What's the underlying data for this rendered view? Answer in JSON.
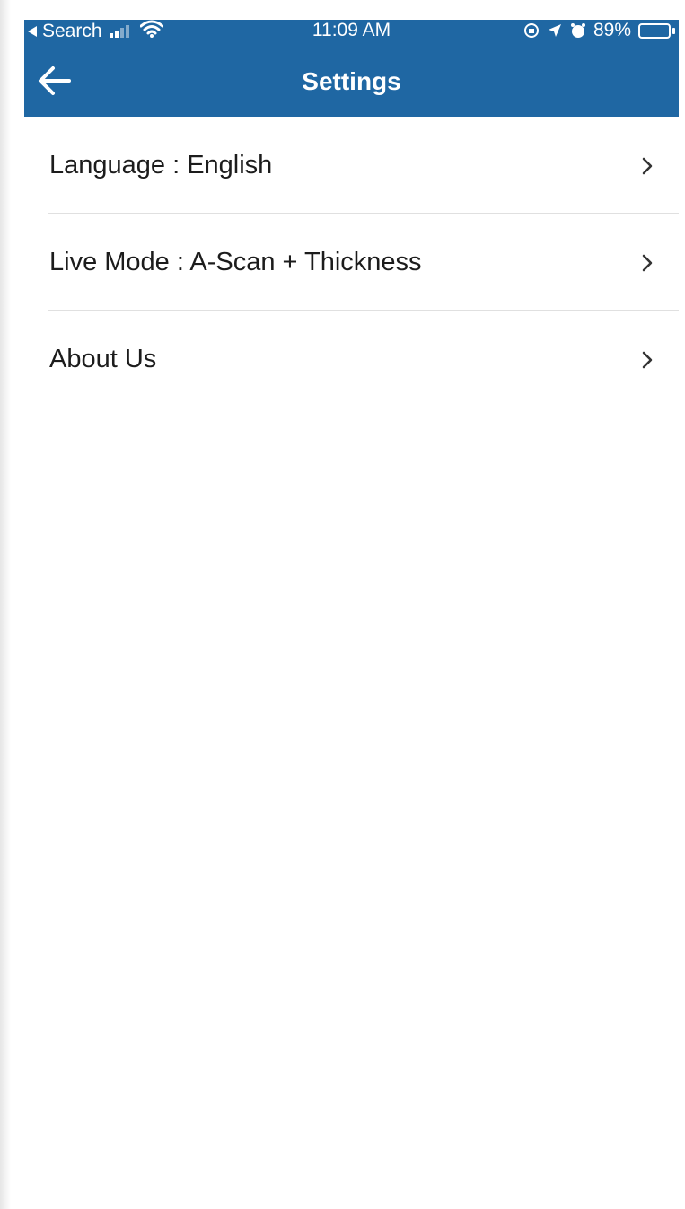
{
  "status_bar": {
    "back_app": "Search",
    "time": "11:09 AM",
    "battery_text": "89%",
    "battery_level": 0.89
  },
  "header": {
    "title": "Settings",
    "color": "#1f67a3"
  },
  "settings": {
    "items": [
      {
        "label": "Language : English"
      },
      {
        "label": "Live Mode : A-Scan + Thickness"
      },
      {
        "label": "About Us"
      }
    ]
  },
  "icons": {
    "back": "arrow-left-icon",
    "chevron": "chevron-right-icon"
  }
}
